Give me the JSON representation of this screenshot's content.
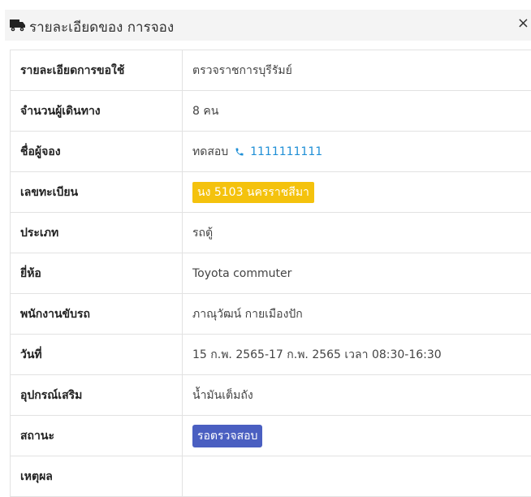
{
  "header": {
    "title": "รายละเอียดของ การจอง",
    "icon": "truck-icon",
    "close_label": "×"
  },
  "details": {
    "rows": [
      {
        "label": "รายละเอียดการขอใช้",
        "value": "ตรวจราชการบุรีรัมย์"
      },
      {
        "label": "จำนวนผู้เดินทาง",
        "value": "8 คน"
      },
      {
        "label": "ชื่อผู้จอง",
        "name": "ทดสอบ",
        "phone": "1111111111"
      },
      {
        "label": "เลขทะเบียน",
        "plate": "นง 5103 นครราชสีมา"
      },
      {
        "label": "ประเภท",
        "value": "รถตู้"
      },
      {
        "label": "ยี่ห้อ",
        "value": "Toyota commuter"
      },
      {
        "label": "พนักงานขับรถ",
        "value": "ภาณุวัฒน์ กายเมืองปัก"
      },
      {
        "label": "วันที่",
        "value": "15 ก.พ. 2565-17 ก.พ. 2565 เวลา 08:30-16:30"
      },
      {
        "label": "อุปกรณ์เสริม",
        "value": "น้ำมันเต็มถัง"
      },
      {
        "label": "สถานะ",
        "status": "รอตรวจสอบ"
      },
      {
        "label": "เหตุผล",
        "value": ""
      }
    ]
  },
  "colors": {
    "plate_badge": "#f4c20d",
    "status_badge": "#4a5fc1",
    "phone_link": "#1f8fd6",
    "header_bg": "#f4f4f4"
  }
}
